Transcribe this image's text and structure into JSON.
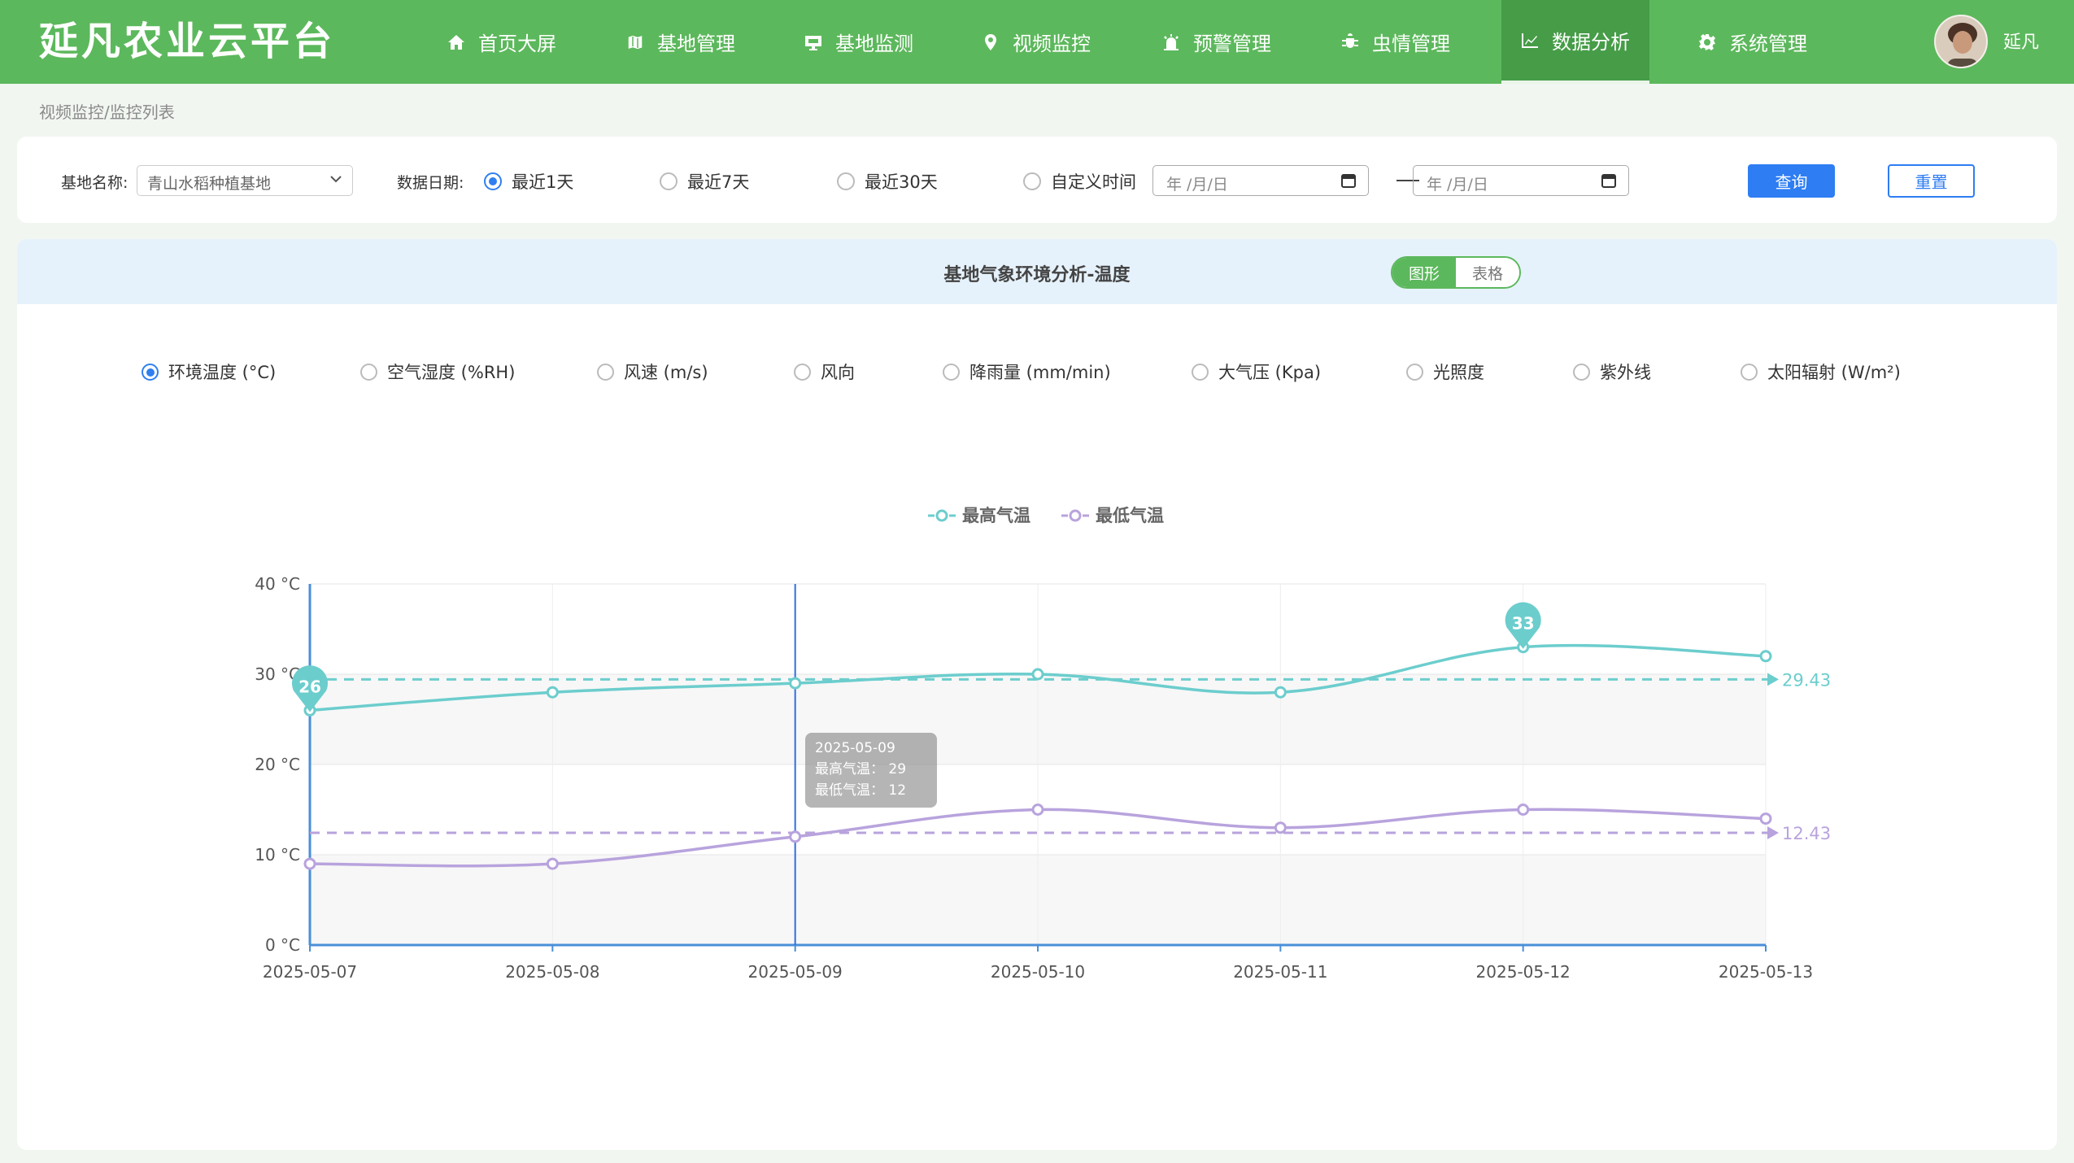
{
  "header": {
    "app_title": "延凡农业云平台",
    "nav": [
      {
        "label": "首页大屏",
        "icon": "home-icon",
        "active": false
      },
      {
        "label": "基地管理",
        "icon": "map-icon",
        "active": false
      },
      {
        "label": "基地监测",
        "icon": "monitor-icon",
        "active": false
      },
      {
        "label": "视频监控",
        "icon": "location-icon",
        "active": false
      },
      {
        "label": "预警管理",
        "icon": "alarm-icon",
        "active": false
      },
      {
        "label": "虫情管理",
        "icon": "bug-icon",
        "active": false
      },
      {
        "label": "数据分析",
        "icon": "chart-icon",
        "active": true
      },
      {
        "label": "系统管理",
        "icon": "gear-icon",
        "active": false
      }
    ],
    "user_name": "延凡"
  },
  "breadcrumb": "视频监控/监控列表",
  "filter": {
    "base_label": "基地名称:",
    "base_value": "青山水稻种植基地",
    "date_label": "数据日期:",
    "date_options": [
      {
        "label": "最近1天",
        "selected": true
      },
      {
        "label": "最近7天",
        "selected": false
      },
      {
        "label": "最近30天",
        "selected": false
      },
      {
        "label": "自定义时间",
        "selected": false
      }
    ],
    "start_placeholder": "年 /月/日",
    "end_placeholder": "年 /月/日",
    "query_label": "查询",
    "reset_label": "重置"
  },
  "panel": {
    "title": "基地气象环境分析-温度",
    "view_chart": "图形",
    "view_table": "表格",
    "metrics": [
      {
        "label": "环境温度 (°C)",
        "selected": true
      },
      {
        "label": "空气湿度 (%RH)",
        "selected": false
      },
      {
        "label": "风速 (m/s)",
        "selected": false
      },
      {
        "label": "风向",
        "selected": false
      },
      {
        "label": "降雨量 (mm/min)",
        "selected": false
      },
      {
        "label": "大气压 (Kpa)",
        "selected": false
      },
      {
        "label": "光照度",
        "selected": false
      },
      {
        "label": "紫外线",
        "selected": false
      },
      {
        "label": "太阳辐射 (W/m²)",
        "selected": false
      }
    ]
  },
  "tooltip": {
    "date": "2025-05-09",
    "high": "最高气温： 29",
    "low": "最低气温： 12"
  },
  "colors": {
    "high": "#6ccdcd",
    "low": "#b8a3dd",
    "brand": "#5cb85c",
    "accent": "#2e7df3"
  },
  "chart_data": {
    "type": "line",
    "categories": [
      "2025-05-07",
      "2025-05-08",
      "2025-05-09",
      "2025-05-10",
      "2025-05-11",
      "2025-05-12",
      "2025-05-13"
    ],
    "series": [
      {
        "name": "最高气温",
        "values": [
          26,
          28,
          29,
          30,
          28,
          33,
          32
        ],
        "average": 29.43,
        "max_label": "33",
        "min_label": "26"
      },
      {
        "name": "最低气温",
        "values": [
          9,
          9,
          12,
          15,
          13,
          15,
          14
        ],
        "average": 12.43
      }
    ],
    "y_ticks": [
      "0 °C",
      "10 °C",
      "20 °C",
      "30 °C",
      "40 °C"
    ],
    "ylim": [
      0,
      40
    ],
    "average_labels": [
      "29.43",
      "12.43"
    ],
    "highlight_category": "2025-05-09",
    "grid": true,
    "legend_position": "top-center"
  }
}
